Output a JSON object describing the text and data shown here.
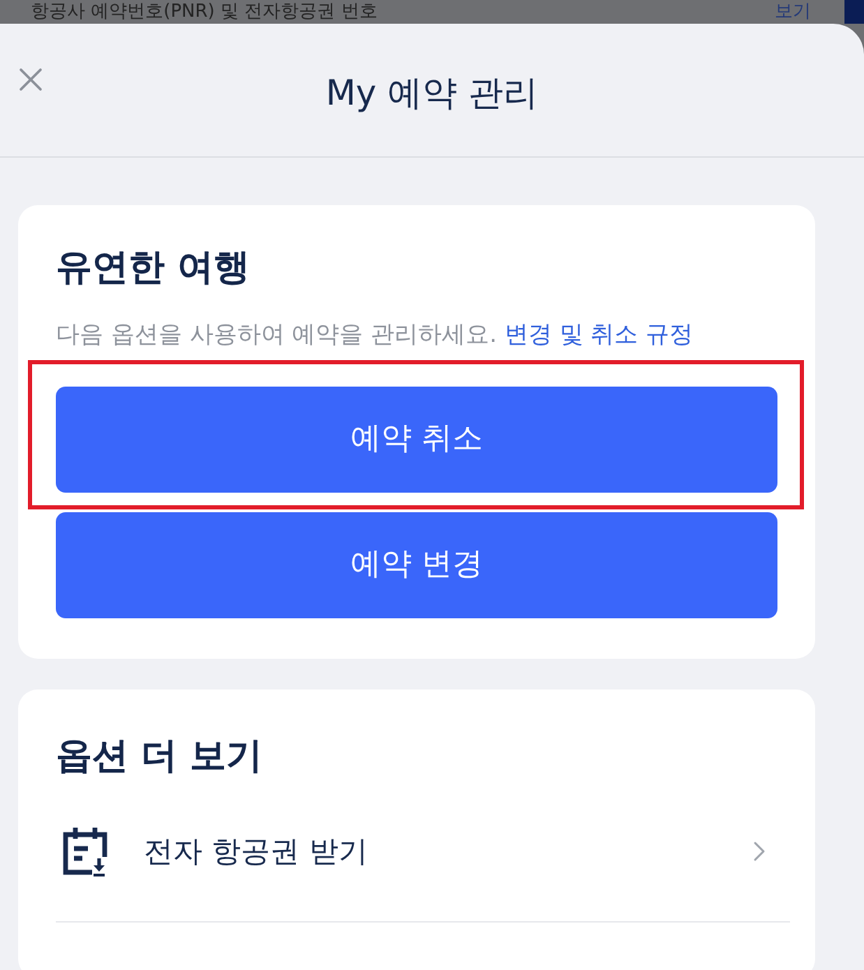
{
  "background_page": {
    "text": "항공사 예약번호(PNR) 및 전자항공권 번호",
    "link": "보기"
  },
  "sheet": {
    "title": "My 예약 관리"
  },
  "flexible_travel": {
    "title": "유연한 여행",
    "description": "다음 옵션을 사용하여 예약을 관리하세요.",
    "policy_link": "변경 및 취소 규정",
    "actions": [
      {
        "label": "예약 취소",
        "highlighted": true
      },
      {
        "label": "예약 변경",
        "highlighted": false
      }
    ]
  },
  "more_options": {
    "title": "옵션 더 보기",
    "items": [
      {
        "label": "전자 항공권 받기"
      }
    ]
  }
}
